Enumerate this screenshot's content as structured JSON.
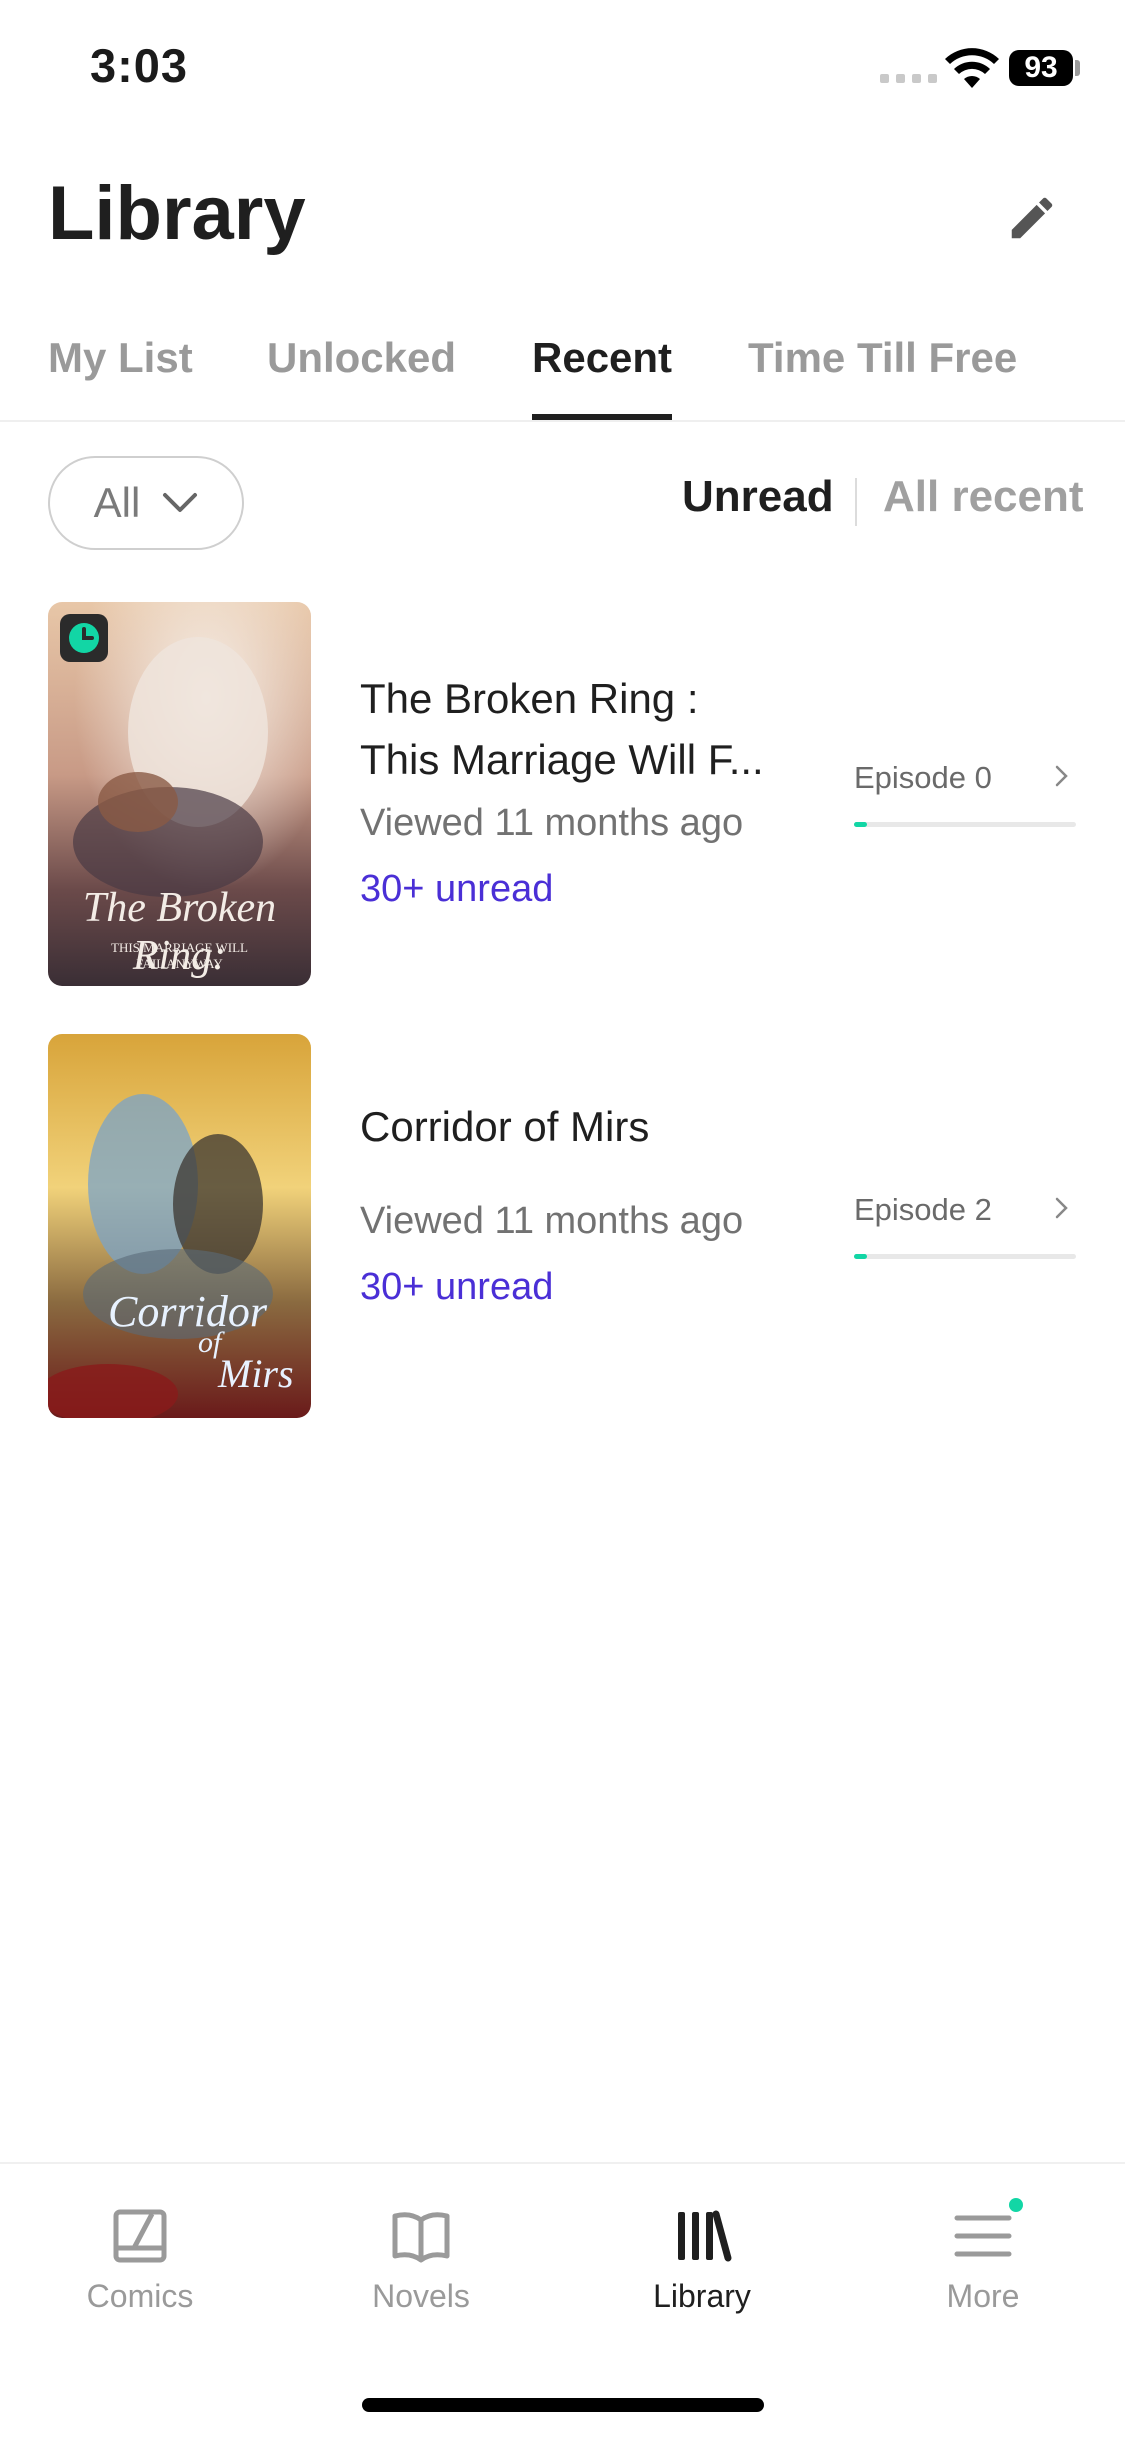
{
  "status_bar": {
    "time": "3:03",
    "battery": "93"
  },
  "header": {
    "title": "Library",
    "edit_icon": "pencil-icon"
  },
  "tabs": [
    {
      "label": "My List",
      "active": false
    },
    {
      "label": "Unlocked",
      "active": false
    },
    {
      "label": "Recent",
      "active": true
    },
    {
      "label": "Time Till Free",
      "active": false
    }
  ],
  "filter": {
    "selected": "All",
    "toggle_active": "Unread",
    "toggle_inactive": "All recent"
  },
  "items": [
    {
      "title_line1": "The Broken Ring :",
      "title_line2": "This Marriage Will F...",
      "viewed": "Viewed 11 months ago",
      "unread": "30+ unread",
      "episode": "Episode 0",
      "progress": 0.06,
      "cover_title": "The Broken Ring:",
      "cover_subtitle": "THIS MARRIAGE WILL FAIL ANYWAY",
      "badge": "clock-icon"
    },
    {
      "title_line1": "Corridor of Mirs",
      "viewed": "Viewed 11 months ago",
      "unread": "30+ unread",
      "episode": "Episode 2",
      "progress": 0.06,
      "cover_title": "Corridor",
      "cover_title_2": "of",
      "cover_title_3": "Mirs"
    }
  ],
  "bottom_nav": [
    {
      "label": "Comics",
      "icon": "comics-icon",
      "active": false
    },
    {
      "label": "Novels",
      "icon": "book-icon",
      "active": false
    },
    {
      "label": "Library",
      "icon": "library-icon",
      "active": true
    },
    {
      "label": "More",
      "icon": "menu-icon",
      "active": false,
      "badge": true
    }
  ],
  "colors": {
    "accent_unread": "#4a2fd6",
    "progress": "#12d6a5"
  }
}
